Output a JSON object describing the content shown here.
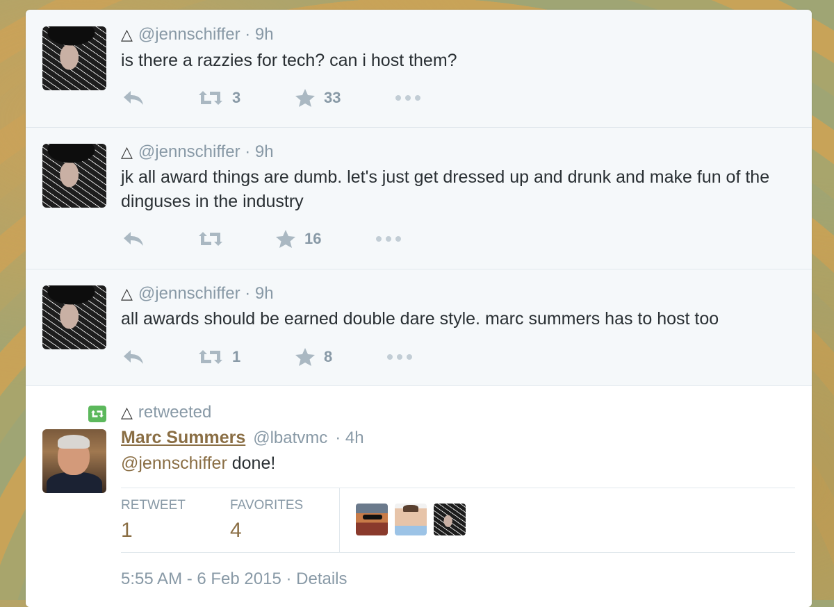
{
  "colors": {
    "link_brown": "#8a6e44",
    "muted": "#8899a6",
    "icon": "#aab8c2",
    "retweet_green": "#5cb85c"
  },
  "tweets": [
    {
      "icon": "triangle-icon",
      "handle": "@jennschiffer",
      "time": "· 9h",
      "text": "is there a razzies for tech? can i host them?",
      "retweets": "3",
      "favorites": "33"
    },
    {
      "icon": "triangle-icon",
      "handle": "@jennschiffer",
      "time": "· 9h",
      "text": "jk all award things are dumb. let's just get dressed up and drunk and make fun of the dinguses in the industry",
      "retweets": "",
      "favorites": "16"
    },
    {
      "icon": "triangle-icon",
      "handle": "@jennschiffer",
      "time": "· 9h",
      "text": "all awards should be earned double dare style. marc summers has to host too",
      "retweets": "1",
      "favorites": "8"
    }
  ],
  "retweet": {
    "banner_label": "retweeted",
    "name": "Marc Summers",
    "handle": "@lbatvmc",
    "time": "· 4h",
    "mention": "@jennschiffer",
    "text": " done!",
    "retweet_label": "RETWEET",
    "retweet_count": "1",
    "favorites_label": "FAVORITES",
    "favorites_count": "4",
    "footer": "5:55 AM - 6 Feb 2015 · Details"
  }
}
